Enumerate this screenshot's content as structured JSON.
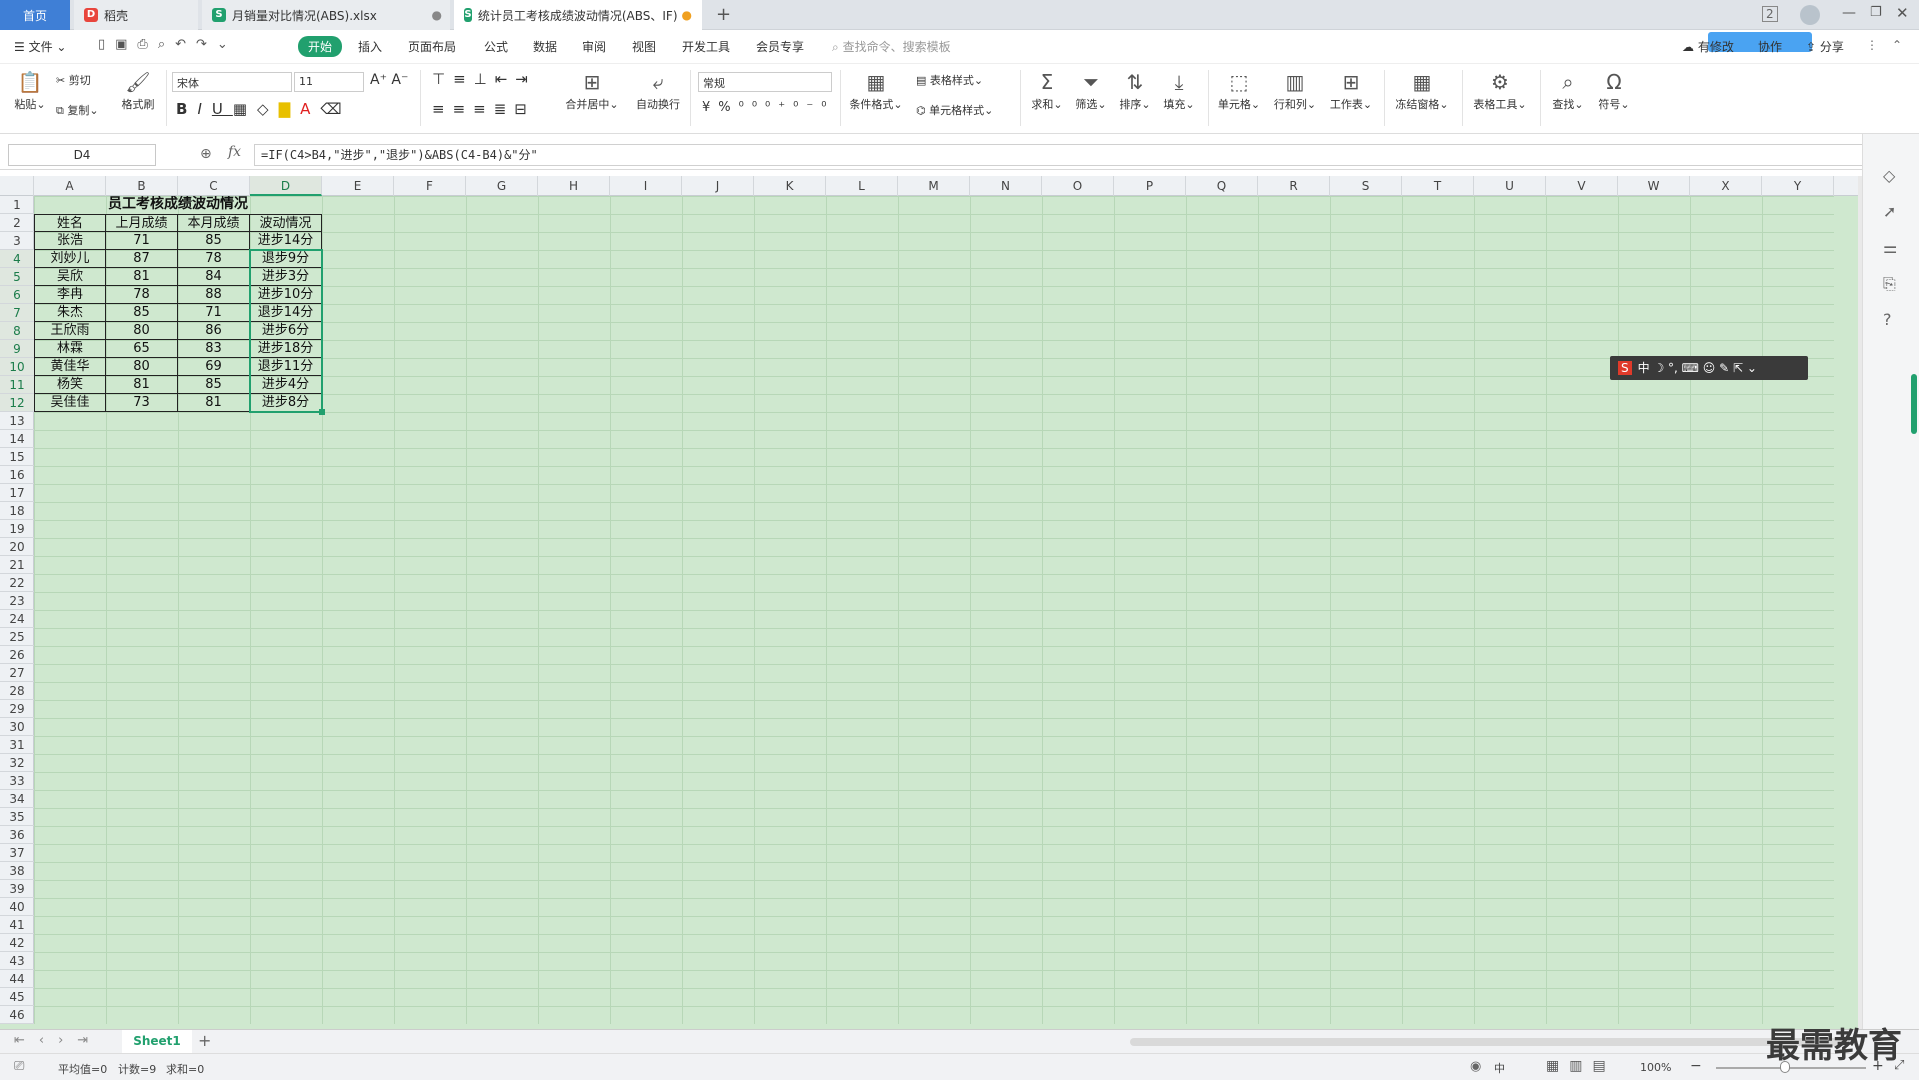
{
  "tabs": {
    "home": "首页",
    "daoke": "稻壳",
    "file1": "月销量对比情况(ABS).xlsx",
    "file2": "统计员工考核成绩波动情况(ABS、IF)"
  },
  "menu": {
    "file": "文件",
    "items": [
      "开始",
      "插入",
      "页面布局",
      "公式",
      "数据",
      "审阅",
      "视图",
      "开发工具",
      "会员专享"
    ],
    "search_placeholder": "查找命令、搜索模板",
    "right": [
      "有修改",
      "协作",
      "分享"
    ]
  },
  "ribbon": {
    "paste": "粘贴",
    "cut": "剪切",
    "copy": "复制",
    "format_painter": "格式刷",
    "font_name": "宋体",
    "font_size": "11",
    "merge_center": "合并居中",
    "wrap": "自动换行",
    "number_format": "常规",
    "cond_format": "条件格式",
    "table_style": "表格样式",
    "cell_style": "单元格样式",
    "sum": "求和",
    "filter": "筛选",
    "sort": "排序",
    "fill": "填充",
    "cell": "单元格",
    "row_col": "行和列",
    "worksheet": "工作表",
    "freeze": "冻结窗格",
    "table_tools": "表格工具",
    "find": "查找",
    "symbol": "符号"
  },
  "formula_bar": {
    "name_box": "D4",
    "fx": "fx",
    "formula": "=IF(C4>B4,\"进步\",\"退步\")&ABS(C4-B4)&\"分\""
  },
  "columns": [
    "A",
    "B",
    "C",
    "D",
    "E",
    "F",
    "G",
    "H",
    "I",
    "J",
    "K",
    "L",
    "M",
    "N",
    "O",
    "P",
    "Q",
    "R",
    "S",
    "T",
    "U",
    "V",
    "W",
    "X",
    "Y"
  ],
  "selected_column": "D",
  "row_count": 46,
  "table": {
    "title": "员工考核成绩波动情况",
    "headers": [
      "姓名",
      "上月成绩",
      "本月成绩",
      "波动情况"
    ],
    "rows": [
      [
        "张浩",
        "71",
        "85",
        "进步14分"
      ],
      [
        "刘妙儿",
        "87",
        "78",
        "退步9分"
      ],
      [
        "吴欣",
        "81",
        "84",
        "进步3分"
      ],
      [
        "李冉",
        "78",
        "88",
        "进步10分"
      ],
      [
        "朱杰",
        "85",
        "71",
        "退步14分"
      ],
      [
        "王欣雨",
        "80",
        "86",
        "进步6分"
      ],
      [
        "林霖",
        "65",
        "83",
        "进步18分"
      ],
      [
        "黄佳华",
        "80",
        "69",
        "退步11分"
      ],
      [
        "杨笑",
        "81",
        "85",
        "进步4分"
      ],
      [
        "吴佳佳",
        "73",
        "81",
        "进步8分"
      ]
    ]
  },
  "sheet_tabs": {
    "active": "Sheet1",
    "add": "+"
  },
  "status": {
    "average": "平均值=0",
    "count": "计数=9",
    "sum": "求和=0",
    "zoom": "100%",
    "ime_mode": "中"
  },
  "ime_bar": {
    "lang": "中"
  },
  "watermark": "最需教育",
  "colors": {
    "accent": "#21a06e",
    "sheet_bg": "#cfe8cf",
    "home_tab": "#3f7fd6"
  }
}
